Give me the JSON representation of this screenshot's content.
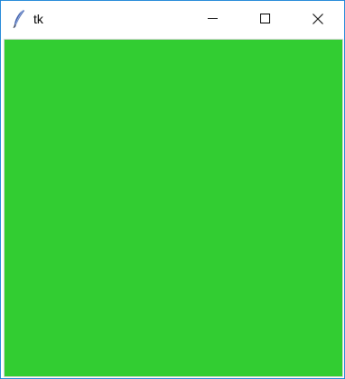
{
  "window": {
    "title": "tk",
    "app_icon": "tk-feather-icon"
  },
  "controls": {
    "minimize": "minimize-icon",
    "maximize": "maximize-icon",
    "close": "close-icon"
  },
  "canvas": {
    "fill_color": "#32cd32"
  },
  "colors": {
    "window_border": "#1883d7",
    "titlebar_bg": "#ffffff"
  }
}
